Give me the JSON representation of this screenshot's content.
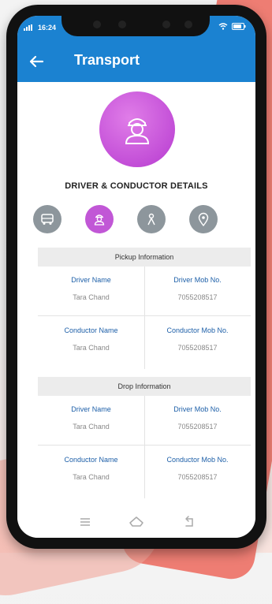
{
  "status": {
    "time": "16:24"
  },
  "app_bar": {
    "title": "Transport"
  },
  "section_title": "DRIVER & CONDUCTOR DETAILS",
  "pickup": {
    "heading": "Pickup Information",
    "driver_name_label": "Driver Name",
    "driver_name_value": "Tara Chand",
    "driver_mob_label": "Driver Mob No.",
    "driver_mob_value": "7055208517",
    "conductor_name_label": "Conductor Name",
    "conductor_name_value": "Tara Chand",
    "conductor_mob_label": "Conductor Mob No.",
    "conductor_mob_value": "7055208517"
  },
  "drop": {
    "heading": "Drop Information",
    "driver_name_label": "Driver Name",
    "driver_name_value": "Tara Chand",
    "driver_mob_label": "Driver Mob No.",
    "driver_mob_value": "7055208517",
    "conductor_name_label": "Conductor Name",
    "conductor_name_value": "Tara Chand",
    "conductor_mob_label": "Conductor Mob No.",
    "conductor_mob_value": "7055208517"
  },
  "icons": {
    "tabs": [
      "bus-icon",
      "driver-icon",
      "route-icon",
      "location-pin-icon"
    ],
    "nav": [
      "menu-icon",
      "home-icon",
      "back-nav-icon"
    ]
  },
  "colors": {
    "primary": "#1b82d1",
    "accent": "#c157d6",
    "inactive": "#8d969c",
    "label": "#1d5fa8"
  }
}
